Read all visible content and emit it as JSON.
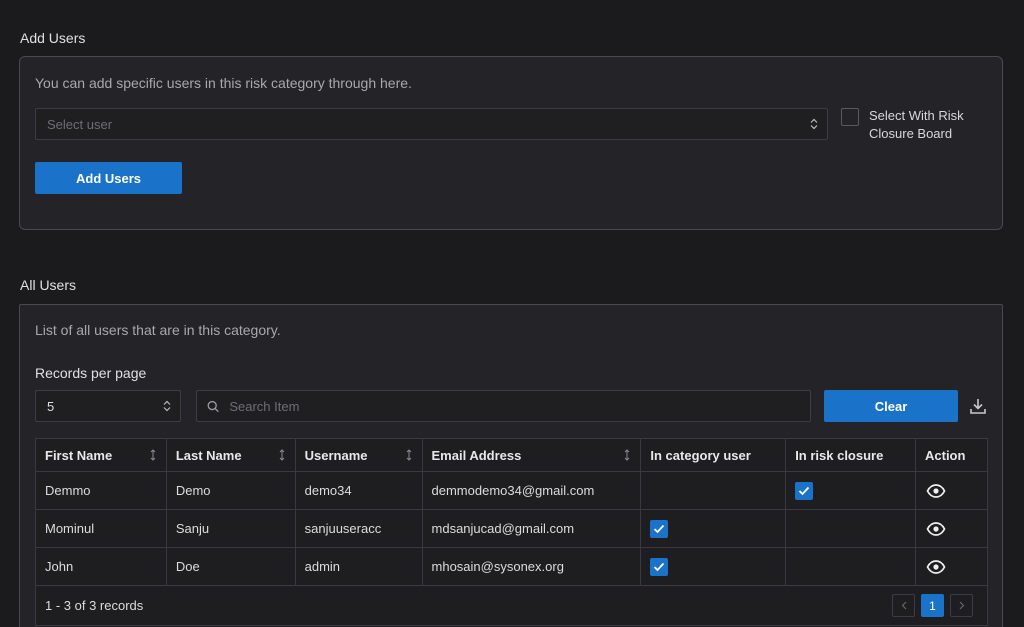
{
  "add_users": {
    "title": "Add Users",
    "description": "You can add specific users in this risk category through here.",
    "select_placeholder": "Select user",
    "checkbox_label_line1": "Select With Risk",
    "checkbox_label_line2": "Closure Board",
    "add_button": "Add Users"
  },
  "all_users": {
    "title": "All Users",
    "description": "List of all users that are in this category.",
    "records_per_page_label": "Records per page",
    "records_per_page_value": "5",
    "search_placeholder": "Search Item",
    "clear_button": "Clear",
    "columns": [
      "First Name",
      "Last Name",
      "Username",
      "Email Address",
      "In category user",
      "In risk closure",
      "Action"
    ],
    "rows": [
      {
        "first": "Demmo",
        "last": "Demo",
        "username": "demo34",
        "email": "demmodemo34@gmail.com",
        "in_category": false,
        "in_risk_closure": true
      },
      {
        "first": "Mominul",
        "last": "Sanju",
        "username": "sanjuuseracc",
        "email": "mdsanjucad@gmail.com",
        "in_category": true,
        "in_risk_closure": false
      },
      {
        "first": "John",
        "last": "Doe",
        "username": "admin",
        "email": "mhosain@sysonex.org",
        "in_category": true,
        "in_risk_closure": false
      }
    ],
    "records_summary": "1 - 3 of 3 records",
    "current_page": "1"
  },
  "colors": {
    "accent": "#1a73c9",
    "background": "#1b1b1d",
    "card": "#242428"
  }
}
